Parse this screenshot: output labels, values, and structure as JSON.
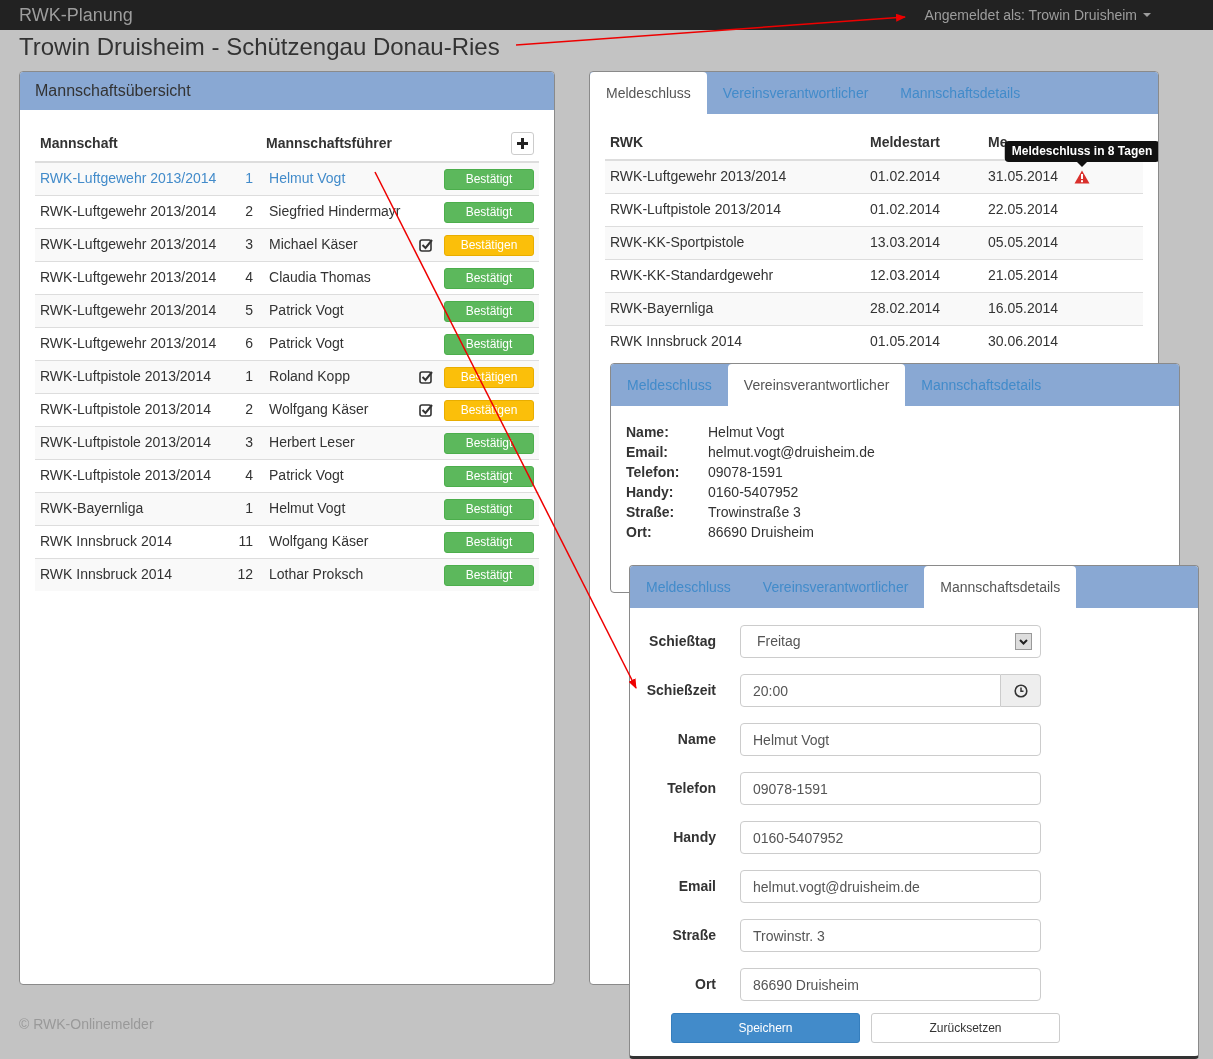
{
  "navbar": {
    "brand": "RWK-Planung",
    "user_menu": "Angemeldet als: Trowin Druisheim"
  },
  "page_title": "Trowin Druisheim - Schützengau Donau-Ries",
  "team_panel": {
    "title": "Mannschaftsübersicht",
    "columns": [
      "Mannschaft",
      "Mannschaftsführer"
    ],
    "rows": [
      {
        "team": "RWK-Luftgewehr 2013/2014",
        "number": "1",
        "leader": "Helmut Vogt",
        "selected": true,
        "confirmed": true,
        "status": "Bestätigt"
      },
      {
        "team": "RWK-Luftgewehr 2013/2014",
        "number": "2",
        "leader": "Siegfried Hindermayr",
        "selected": false,
        "confirmed": true,
        "status": "Bestätigt"
      },
      {
        "team": "RWK-Luftgewehr 2013/2014",
        "number": "3",
        "leader": "Michael Käser",
        "selected": false,
        "confirmed": false,
        "status": "Bestätigen"
      },
      {
        "team": "RWK-Luftgewehr 2013/2014",
        "number": "4",
        "leader": "Claudia Thomas",
        "selected": false,
        "confirmed": true,
        "status": "Bestätigt"
      },
      {
        "team": "RWK-Luftgewehr 2013/2014",
        "number": "5",
        "leader": "Patrick Vogt",
        "selected": false,
        "confirmed": true,
        "status": "Bestätigt"
      },
      {
        "team": "RWK-Luftgewehr 2013/2014",
        "number": "6",
        "leader": "Patrick Vogt",
        "selected": false,
        "confirmed": true,
        "status": "Bestätigt"
      },
      {
        "team": "RWK-Luftpistole 2013/2014",
        "number": "1",
        "leader": "Roland Kopp",
        "selected": false,
        "confirmed": false,
        "status": "Bestätigen"
      },
      {
        "team": "RWK-Luftpistole 2013/2014",
        "number": "2",
        "leader": "Wolfgang Käser",
        "selected": false,
        "confirmed": false,
        "status": "Bestätigen"
      },
      {
        "team": "RWK-Luftpistole 2013/2014",
        "number": "3",
        "leader": "Herbert Leser",
        "selected": false,
        "confirmed": true,
        "status": "Bestätigt"
      },
      {
        "team": "RWK-Luftpistole 2013/2014",
        "number": "4",
        "leader": "Patrick Vogt",
        "selected": false,
        "confirmed": true,
        "status": "Bestätigt"
      },
      {
        "team": "RWK-Bayernliga",
        "number": "1",
        "leader": "Helmut Vogt",
        "selected": false,
        "confirmed": true,
        "status": "Bestätigt"
      },
      {
        "team": "RWK Innsbruck 2014",
        "number": "11",
        "leader": "Wolfgang Käser",
        "selected": false,
        "confirmed": true,
        "status": "Bestätigt"
      },
      {
        "team": "RWK Innsbruck 2014",
        "number": "12",
        "leader": "Lothar Proksch",
        "selected": false,
        "confirmed": true,
        "status": "Bestätigt"
      }
    ]
  },
  "deadline_panel": {
    "tabs": [
      {
        "label": "Meldeschluss",
        "selected": true
      },
      {
        "label": "Vereinsverantwortlicher",
        "selected": false
      },
      {
        "label": "Mannschaftsdetails",
        "selected": false
      }
    ],
    "columns": [
      "RWK",
      "Meldestart",
      "Me"
    ],
    "rows": [
      {
        "rwk": "RWK-Luftgewehr 2013/2014",
        "start": "01.02.2014",
        "end": "31.05.2014",
        "warning": true,
        "tooltip": "Meldeschluss in 8 Tagen"
      },
      {
        "rwk": "RWK-Luftpistole 2013/2014",
        "start": "01.02.2014",
        "end": "22.05.2014",
        "warning": false
      },
      {
        "rwk": "RWK-KK-Sportpistole",
        "start": "13.03.2014",
        "end": "05.05.2014",
        "warning": false
      },
      {
        "rwk": "RWK-KK-Standardgewehr",
        "start": "12.03.2014",
        "end": "21.05.2014",
        "warning": false
      },
      {
        "rwk": "RWK-Bayernliga",
        "start": "28.02.2014",
        "end": "16.05.2014",
        "warning": false
      },
      {
        "rwk": "RWK Innsbruck 2014",
        "start": "01.05.2014",
        "end": "30.06.2014",
        "warning": false
      }
    ]
  },
  "contact_panel": {
    "tabs": [
      {
        "label": "Meldeschluss",
        "selected": false
      },
      {
        "label": "Vereinsverantwortlicher",
        "selected": true
      },
      {
        "label": "Mannschaftsdetails",
        "selected": false
      }
    ],
    "fields": [
      {
        "label": "Name:",
        "value": "Helmut Vogt"
      },
      {
        "label": "Email:",
        "value": "helmut.vogt@druisheim.de"
      },
      {
        "label": "Telefon:",
        "value": "09078-1591"
      },
      {
        "label": "Handy:",
        "value": "0160-5407952"
      },
      {
        "label": "Straße:",
        "value": "Trowinstraße 3"
      },
      {
        "label": "Ort:",
        "value": "86690 Druisheim"
      }
    ]
  },
  "details_panel": {
    "tabs": [
      {
        "label": "Meldeschluss",
        "selected": false
      },
      {
        "label": "Vereinsverantwortlicher",
        "selected": false
      },
      {
        "label": "Mannschaftsdetails",
        "selected": true
      }
    ],
    "fields": [
      {
        "kind": "select",
        "label": "Schießtag",
        "value": "Freitag"
      },
      {
        "kind": "time",
        "label": "Schießzeit",
        "value": "20:00"
      },
      {
        "kind": "text",
        "label": "Name",
        "value": "Helmut Vogt"
      },
      {
        "kind": "text",
        "label": "Telefon",
        "value": "09078-1591"
      },
      {
        "kind": "text",
        "label": "Handy",
        "value": "0160-5407952"
      },
      {
        "kind": "text",
        "label": "Email",
        "value": "helmut.vogt@druisheim.de"
      },
      {
        "kind": "text",
        "label": "Straße",
        "value": "Trowinstr. 3"
      },
      {
        "kind": "text",
        "label": "Ort",
        "value": "86690 Druisheim"
      }
    ],
    "buttons": [
      {
        "label": "Speichern",
        "primary": true
      },
      {
        "label": "Zurücksetzen",
        "primary": false
      }
    ]
  },
  "footer": "© RWK-Onlinemelder"
}
